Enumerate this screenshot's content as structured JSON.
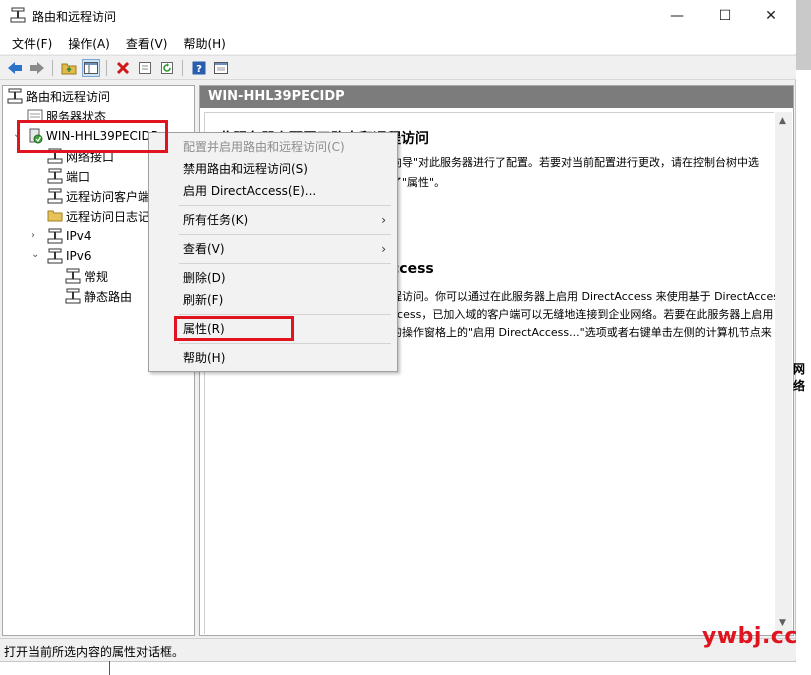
{
  "window": {
    "title": "路由和远程访问",
    "minimize_icon": "minimize-icon",
    "maximize_icon": "maximize-icon",
    "close_icon": "close-icon"
  },
  "menubar": {
    "file": "文件(F)",
    "action": "操作(A)",
    "view": "查看(V)",
    "help": "帮助(H)"
  },
  "toolbar": {
    "icons": [
      "back-arrow-icon",
      "forward-arrow-icon",
      "up-folder-icon",
      "show-tree-icon",
      "delete-icon",
      "properties-icon",
      "refresh-icon",
      "help-icon",
      "console-icon"
    ]
  },
  "tree": {
    "root": "路由和远程访问",
    "server_status": "服务器状态",
    "server": "WIN-HHL39PECIDP",
    "network_interfaces": "网络接口",
    "ports": "端口",
    "remote_clients": "远程访问客户端",
    "remote_logging": "远程访问日志记录",
    "ipv4": "IPv4",
    "ipv6": "IPv6",
    "general": "常规",
    "static_routes": "静态路由"
  },
  "pane": {
    "header": "WIN-HHL39PECIDP",
    "heading1": "此服务器上配置了路由和远程访问",
    "para1_line1": "向导\"对此服务器进行了配置。若要对当前配置进行更改，请在控制台树中选",
    "para1_line2": "了\"属性\"。",
    "heading2": "ccess",
    "para2_line1": "程访问。你可以通过在此服务器上启用 DirectAccess 来使用基于 DirectAccess",
    "para2_line2": "ccess，已加入域的客户端可以无缝地连接到企业网络。若要在此服务器上启用",
    "para2_line3": "的操作窗格上的\"启用 DirectAccess...\"选项或者右键单击左侧的计算机节点来"
  },
  "context_menu": {
    "configure": "配置并启用路由和远程访问(C)",
    "disable": "禁用路由和远程访问(S)",
    "enable_da": "启用 DirectAccess(E)...",
    "all_tasks": "所有任务(K)",
    "view": "查看(V)",
    "delete": "删除(D)",
    "refresh": "刷新(F)",
    "properties": "属性(R)",
    "help": "帮助(H)",
    "submenu_arrow": "›"
  },
  "statusbar": {
    "text": "打开当前所选内容的属性对话框。"
  },
  "peek": {
    "text": "网络"
  },
  "watermark": {
    "text": "ywbj.cc"
  },
  "colors": {
    "highlight_red": "#e0141e",
    "pane_header": "#7c7c7c"
  }
}
